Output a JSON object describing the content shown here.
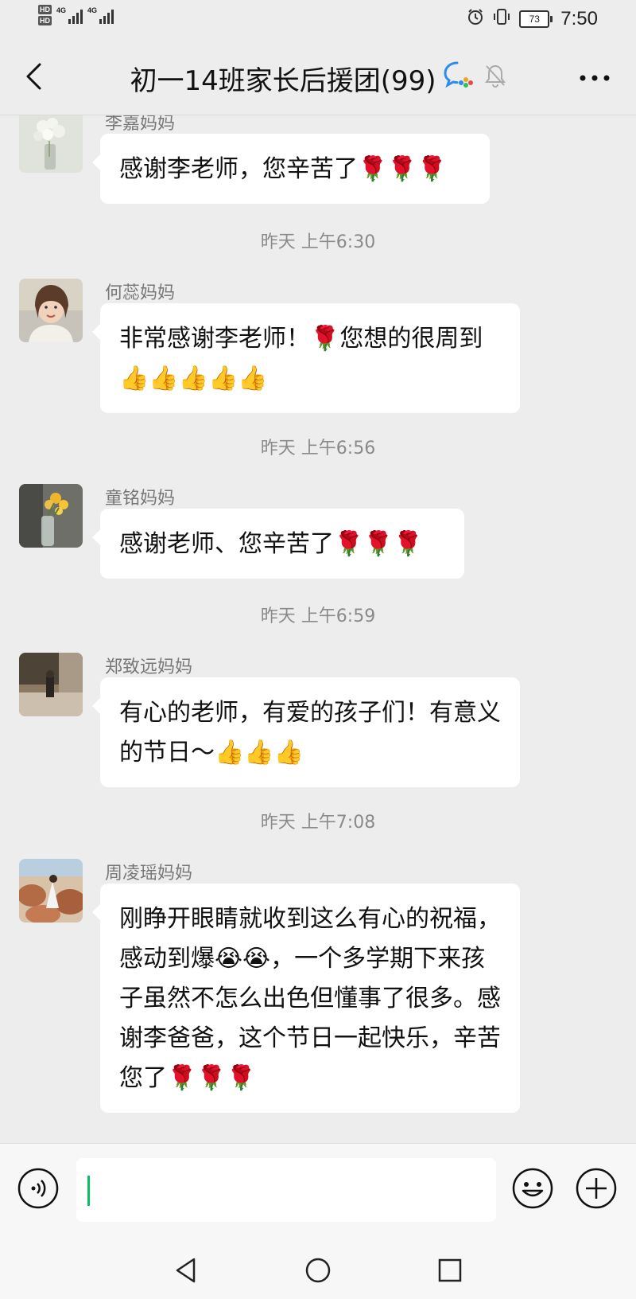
{
  "status_bar": {
    "hd1": "HD",
    "hd2": "HD",
    "net1": "4G",
    "net2": "4G",
    "battery": "73",
    "time": "7:50"
  },
  "header": {
    "title": "初一14班家长后援团(99)",
    "icons": [
      "back-chevron-icon",
      "chat-bubble-icon",
      "mute-bell-icon",
      "more-dots-icon"
    ]
  },
  "messages": [
    {
      "type": "message",
      "sender": "李嘉妈妈",
      "text": "感谢李老师，您辛苦了🌹🌹🌹"
    },
    {
      "type": "timestamp",
      "text": "昨天 上午6:30"
    },
    {
      "type": "message",
      "sender": "何蕊妈妈",
      "text": "非常感谢李老师！🌹您想的很周到👍👍👍👍👍"
    },
    {
      "type": "timestamp",
      "text": "昨天 上午6:56"
    },
    {
      "type": "message",
      "sender": "童铭妈妈",
      "text": "感谢老师、您辛苦了🌹🌹🌹"
    },
    {
      "type": "timestamp",
      "text": "昨天 上午6:59"
    },
    {
      "type": "message",
      "sender": "郑致远妈妈",
      "text": "有心的老师，有爱的孩子们！有意义的节日～👍👍👍"
    },
    {
      "type": "timestamp",
      "text": "昨天 上午7:08"
    },
    {
      "type": "message",
      "sender": "周凌瑶妈妈",
      "text": "刚睁开眼睛就收到这么有心的祝福，感动到爆😭😭，一个多学期下来孩子虽然不怎么出色但懂事了很多。感谢李爸爸，这个节日一起快乐，辛苦您了🌹🌹🌹"
    }
  ],
  "input_bar": {
    "value": "",
    "icons": [
      "voice-icon",
      "emoji-icon",
      "plus-icon"
    ]
  },
  "nav_bar": {
    "icons": [
      "nav-back-icon",
      "nav-home-icon",
      "nav-recent-icon"
    ]
  },
  "colors": {
    "background": "#ededed",
    "bubble": "#ffffff",
    "accent": "#07c160",
    "timestamp": "#8a8a8a"
  }
}
